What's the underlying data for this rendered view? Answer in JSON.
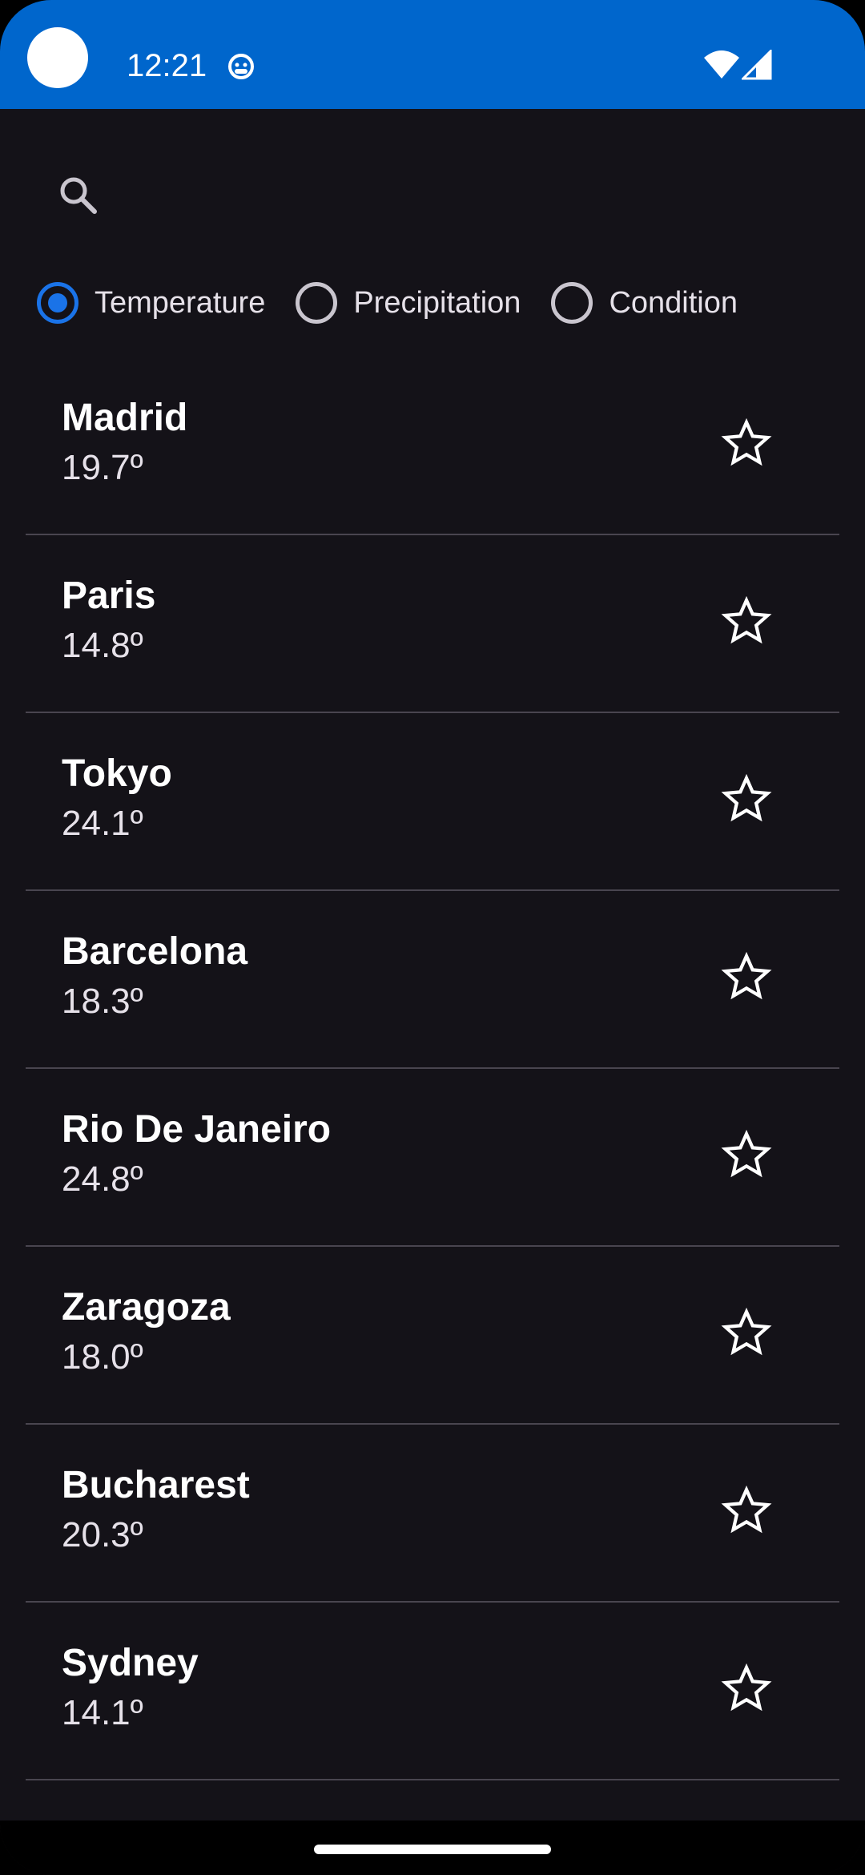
{
  "status_bar": {
    "time": "12:21",
    "background_color": "#0066cc",
    "icons": [
      "app-notification-icon",
      "wifi-icon",
      "signal-icon"
    ]
  },
  "search": {
    "icon": "search-icon"
  },
  "filters": {
    "selected": "Temperature",
    "options": [
      {
        "label": "Temperature",
        "selected": true
      },
      {
        "label": "Precipitation",
        "selected": false
      },
      {
        "label": "Condition",
        "selected": false
      }
    ],
    "accent_color": "#1a73e8"
  },
  "cities": [
    {
      "name": "Madrid",
      "value": "19.7º",
      "favorite": false
    },
    {
      "name": "Paris",
      "value": "14.8º",
      "favorite": false
    },
    {
      "name": "Tokyo",
      "value": "24.1º",
      "favorite": false
    },
    {
      "name": "Barcelona",
      "value": "18.3º",
      "favorite": false
    },
    {
      "name": "Rio De Janeiro",
      "value": "24.8º",
      "favorite": false
    },
    {
      "name": "Zaragoza",
      "value": "18.0º",
      "favorite": false
    },
    {
      "name": "Bucharest",
      "value": "20.3º",
      "favorite": false
    },
    {
      "name": "Sydney",
      "value": "14.1º",
      "favorite": false
    }
  ],
  "theme": {
    "background": "#141218",
    "divider": "#49454f"
  }
}
